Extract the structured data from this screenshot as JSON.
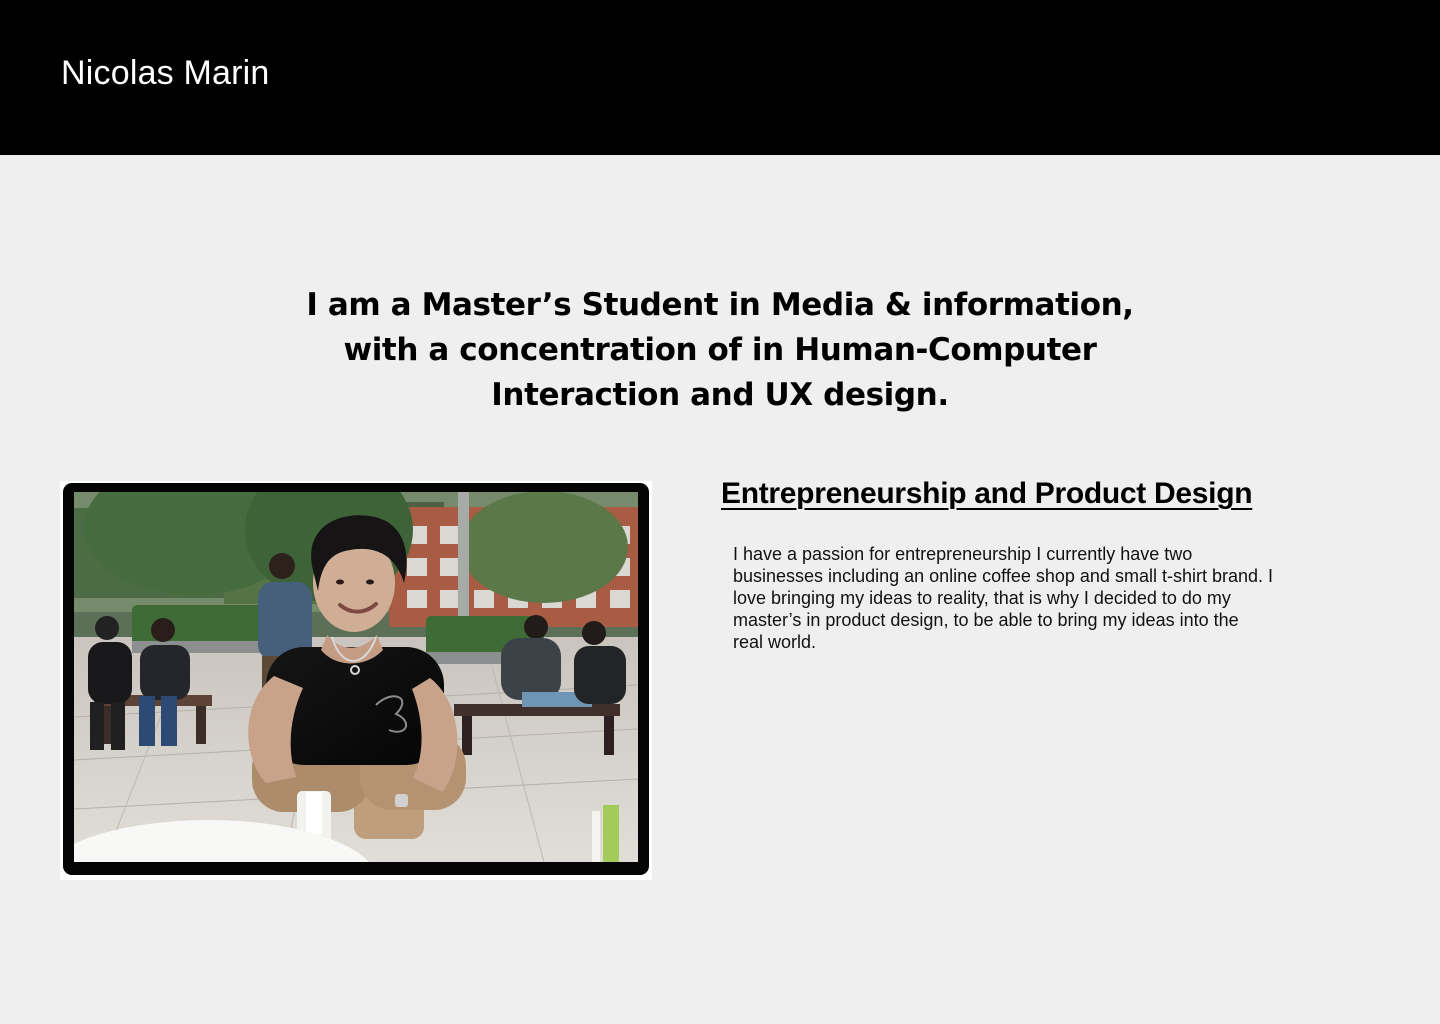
{
  "header": {
    "site_name": "Nicolas Marin"
  },
  "hero": {
    "headline": "I am a Master’s Student in Media & information, with a concentration of in Human-Computer Interaction and UX design."
  },
  "profile_photo": {
    "icon": "person-photo"
  },
  "section": {
    "title": "Entrepreneurship and Product Design",
    "body": "I have a passion for entrepreneurship I currently have two businesses including an online coffee shop and small t-shirt brand. I love bringing my ideas to reality, that is why I decided to do my master’s in product design, to be able to bring my ideas into the real world."
  },
  "colors": {
    "header_background": "#000000",
    "page_background": "#efefef",
    "text": "#000000"
  }
}
